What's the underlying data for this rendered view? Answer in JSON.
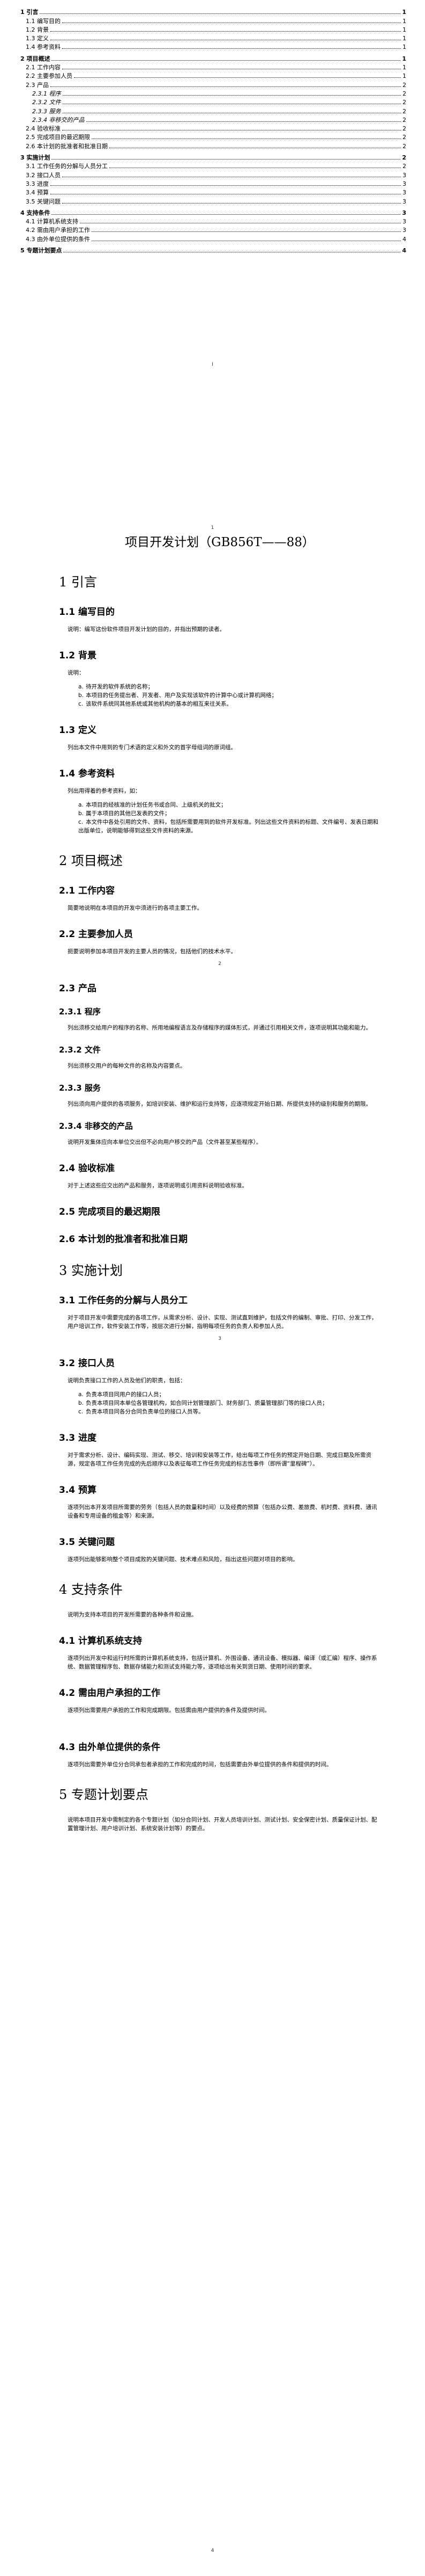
{
  "toc": [
    {
      "level": 1,
      "text": "1 引言",
      "page": "1"
    },
    {
      "level": 2,
      "text": "1.1 编写目的",
      "page": "1"
    },
    {
      "level": 2,
      "text": "1.2 背景",
      "page": "1"
    },
    {
      "level": 2,
      "text": "1.3 定义",
      "page": "1"
    },
    {
      "level": 2,
      "text": "1.4 参考资料",
      "page": "1"
    },
    {
      "level": 1,
      "text": "2 项目概述",
      "page": "1"
    },
    {
      "level": 2,
      "text": "2.1 工作内容",
      "page": "1"
    },
    {
      "level": 2,
      "text": "2.2 主要参加人员",
      "page": "1"
    },
    {
      "level": 2,
      "text": "2.3 产品",
      "page": "2"
    },
    {
      "level": 3,
      "text": "2.3.1 程序",
      "page": "2"
    },
    {
      "level": 3,
      "text": "2.3.2 文件",
      "page": "2"
    },
    {
      "level": 3,
      "text": "2.3.3 服务",
      "page": "2"
    },
    {
      "level": 3,
      "text": "2.3.4 非移交的产品",
      "page": "2"
    },
    {
      "level": 2,
      "text": "2.4 验收标准",
      "page": "2"
    },
    {
      "level": 2,
      "text": "2.5 完成项目的最迟期限",
      "page": "2"
    },
    {
      "level": 2,
      "text": "2.6 本计划的批准者和批准日期",
      "page": "2"
    },
    {
      "level": 1,
      "text": "3 实施计划",
      "page": "2"
    },
    {
      "level": 2,
      "text": "3.1 工作任务的分解与人员分工",
      "page": "2"
    },
    {
      "level": 2,
      "text": "3.2 接口人员",
      "page": "3"
    },
    {
      "level": 2,
      "text": "3.3 进度",
      "page": "3"
    },
    {
      "level": 2,
      "text": "3.4 预算",
      "page": "3"
    },
    {
      "level": 2,
      "text": "3.5 关键问题",
      "page": "3"
    },
    {
      "level": 1,
      "text": "4 支持条件",
      "page": "3"
    },
    {
      "level": 2,
      "text": "4.1 计算机系统支持",
      "page": "3"
    },
    {
      "level": 2,
      "text": "4.2 需由用户承担的工作",
      "page": "3"
    },
    {
      "level": 2,
      "text": "4.3 由外单位提供的条件",
      "page": "4"
    },
    {
      "level": 1,
      "text": "5 专题计划要点",
      "page": "4"
    }
  ],
  "page_numbers": {
    "p_i": "I",
    "p1": "1",
    "p2": "2",
    "p3": "3",
    "p4": "4"
  },
  "doc": {
    "title": "项目开发计划（GB856T——88）",
    "s1": "1 引言",
    "s1_1": "1.1 编写目的",
    "s1_1_text": "说明：编写这份软件项目开发计划的目的，并指出预期的读者。",
    "s1_2": "1.2  背景",
    "s1_2_text": "说明：",
    "s1_2_items": [
      "待开发的软件系统的名称；",
      "本项目的任务提出者、开发者、用户及实现该软件的计算中心或计算机网络；",
      "该软件系统同其他系统或其他机构的基本的相互来往关系。"
    ],
    "s1_3": "1.3 定义",
    "s1_3_text": "列出本文件中用到的专门术语的定义和外文的首字母组词的原词组。",
    "s1_4": "1.4 参考资料",
    "s1_4_text": "列出用得着的参考资料，如：",
    "s1_4_items": [
      "本项目的经核准的计划任务书或合同、上级机关的批文；",
      "属于本项目的其他已发表的文件；",
      "本文件中各处引用的文件、资料，包括所需要用到的软件开发标准。列出这些文件资料的标题、文件编号、发表日期和出版单位，说明能够得到这些文件资料的来源。"
    ],
    "s2": "2 项目概述",
    "s2_1": "2.1 工作内容",
    "s2_1_text": "简要地说明在本项目的开发中须进行的各项主要工作。",
    "s2_2": "2.2 主要参加人员",
    "s2_2_text": "扼要说明参加本项目开发的主要人员的情况，包括他们的技术水平。",
    "s2_3": "2.3 产品",
    "s2_3_1": "2.3.1 程序",
    "s2_3_1_text": "列出须移交给用户的程序的名称、所用地编程语言及存储程序的媒体形式，并通过引用相关文件，逐项说明其功能和能力。",
    "s2_3_2": "2.3.2 文件",
    "s2_3_2_text": "列出须移交用户的每种文件的名称及内容要点。",
    "s2_3_3": "2.3.3 服务",
    "s2_3_3_text": "列出须向用户提供的各项服务，如培训安装、维护和运行支持等，应逐项规定开始日期、所提供支持的级别和服务的期限。",
    "s2_3_4": "2.3.4 非移交的产品",
    "s2_3_4_text": "说明开发集体应向本单位交出但不必向用户移交的产品（文件甚至某些程序）。",
    "s2_4": "2.4 验收标准",
    "s2_4_text": "对于上述这些应交出的产品和服务，逐项说明或引用资料说明验收标准。",
    "s2_5": "2.5 完成项目的最迟期限",
    "s2_6": "2.6 本计划的批准者和批准日期",
    "s3": "3 实施计划",
    "s3_1": "3.1 工作任务的分解与人员分工",
    "s3_1_text": "对于项目开发中需要完成的各项工作，从需求分析、设计、实现、测试直到维护，包括文件的编制、审批、打印、分发工作，用户培训工作，软件安装工作等，按层次进行分解，指明每项任务的负责人和参加人员。",
    "s3_2": "3.2 接口人员",
    "s3_2_text": "说明负责接口工作的人员及他们的职责，包括：",
    "s3_2_items": [
      "负责本项目同用户的接口人员；",
      "负责本项目同本单位各管理机构，如合同计划管理部门、财务部门、质量管理部门等的接口人员；",
      "负责本项目同各分合同负责单位的接口人员等。"
    ],
    "s3_3": "3.3 进度",
    "s3_3_text": "对于需求分析、设计、编码实现、测试、移交、培训和安装等工作，给出每项工作任务的预定开始日期、完成日期及所需资源，规定各项工作任务完成的先后顺序以及表征每项工作任务完成的标志性事件（即所谓“里程碑”）。",
    "s3_4": "3.4 预算",
    "s3_4_text": "逐项列出本开发项目所需要的劳务（包括人员的数量和时间）以及经费的预算（包括办公费、差旅费、机时费、资料费、通讯设备和专用设备的租金等）和来源。",
    "s3_5": "3.5 关键问题",
    "s3_5_text": "逐项列出能够影响整个项目成败的关键问题、技术难点和风险，指出这些问题对项目的影响。",
    "s4": "4 支持条件",
    "s4_text": "说明为支持本项目的开发所需要的各种条件和设施。",
    "s4_1": "4.1 计算机系统支持",
    "s4_1_text": "逐项列出开发中和运行时所需的计算机系统支持，包括计算机、外围设备、通讯设备、模拟器、编译（或汇编）程序、操作系统、数据管理程序包、数据存储能力和测试支持能力等，逐项给出有关到货日期、使用时间的要求。",
    "s4_2": "4.2 需由用户承担的工作",
    "s4_2_text": "逐项列出需要用户承担的工作和完成期限。包括需由用户提供的条件及提供时间。",
    "s4_3": "4.3 由外单位提供的条件",
    "s4_3_text": "逐项列出需要外单位分合同承包者承担的工作和完成的时间，包括需要由外单位提供的条件和提供的时间。",
    "s5": "5 专题计划要点",
    "s5_text": "说明本项目开发中需制定的各个专题计划（如分合同计划、开发人员培训计划、测试计划、安全保密计划、质量保证计划、配置管理计划、用户培训计划、系统安装计划等）的要点。"
  }
}
